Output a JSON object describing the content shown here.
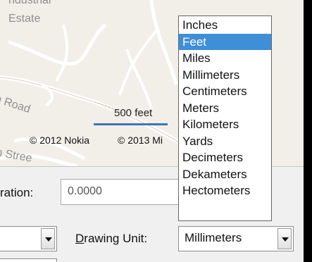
{
  "map": {
    "labels": {
      "top_cut": "ndustrial",
      "estate": "Estate",
      "road": "n Road",
      "street": "n Stree"
    },
    "scale_label": "500 feet",
    "copyright_nokia": "© 2012 Nokia",
    "copyright_mi": "© 2013 Mi"
  },
  "panel": {
    "duration_label": "ration:",
    "duration_value": "0.0000",
    "drawing_unit_label_prefix": "D",
    "drawing_unit_label_rest": "rawing Unit:",
    "drawing_unit_value": "Millimeters"
  },
  "dropdown": {
    "selected": "Feet",
    "options": [
      "Inches",
      "Feet",
      "Miles",
      "Millimeters",
      "Centimeters",
      "Meters",
      "Kilometers",
      "Yards",
      "Decimeters",
      "Dekameters",
      "Hectometers"
    ]
  },
  "colors": {
    "selection": "#3f8ed8",
    "scale_bar": "#3f74b6",
    "map_background": "#f2efe9"
  }
}
